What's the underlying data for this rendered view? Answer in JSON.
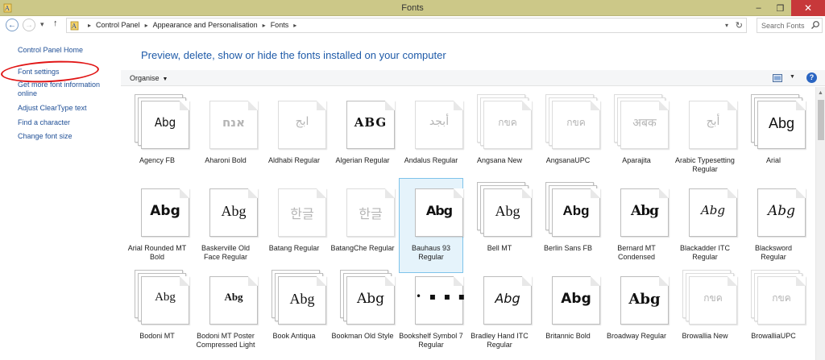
{
  "window": {
    "title": "Fonts",
    "minimize": "–",
    "restore": "❐",
    "close": "✕"
  },
  "address": {
    "crumbs": [
      "Control Panel",
      "Appearance and Personalisation",
      "Fonts"
    ],
    "separator": "▸",
    "search_placeholder": "Search Fonts"
  },
  "tasks": {
    "home": "Control Panel Home",
    "font_settings": "Font settings",
    "more_info": "Get more font information online",
    "cleartype": "Adjust ClearType text",
    "find_char": "Find a character",
    "font_size": "Change font size"
  },
  "main": {
    "heading": "Preview, delete, show or hide the fonts installed on your computer",
    "organise": "Organise"
  },
  "fonts": [
    {
      "name": "Agency FB",
      "sample": "Abg",
      "stack": true,
      "faded": false
    },
    {
      "name": "Aharoni Bold",
      "sample": "אנח",
      "stack": false,
      "faded": true
    },
    {
      "name": "Aldhabi Regular",
      "sample": "ابج",
      "stack": false,
      "faded": true
    },
    {
      "name": "Algerian Regular",
      "sample": "ABG",
      "stack": false,
      "faded": false
    },
    {
      "name": "Andalus Regular",
      "sample": "أبجد",
      "stack": false,
      "faded": true
    },
    {
      "name": "Angsana New",
      "sample": "กขค",
      "stack": true,
      "faded": true
    },
    {
      "name": "AngsanaUPC",
      "sample": "กขค",
      "stack": true,
      "faded": true
    },
    {
      "name": "Aparajita",
      "sample": "अबक",
      "stack": true,
      "faded": true
    },
    {
      "name": "Arabic Typesetting Regular",
      "sample": "أبج",
      "stack": false,
      "faded": true
    },
    {
      "name": "Arial",
      "sample": "Abg",
      "stack": true,
      "faded": false
    },
    {
      "name": "Arial Rounded MT Bold",
      "sample": "Abg",
      "stack": false,
      "faded": false
    },
    {
      "name": "Baskerville Old Face Regular",
      "sample": "Abg",
      "stack": false,
      "faded": false
    },
    {
      "name": "Batang Regular",
      "sample": "한글",
      "stack": false,
      "faded": true
    },
    {
      "name": "BatangChe Regular",
      "sample": "한글",
      "stack": false,
      "faded": true
    },
    {
      "name": "Bauhaus 93 Regular",
      "sample": "Abg",
      "stack": false,
      "faded": false
    },
    {
      "name": "Bell MT",
      "sample": "Abg",
      "stack": true,
      "faded": false
    },
    {
      "name": "Berlin Sans FB",
      "sample": "Abg",
      "stack": true,
      "faded": false
    },
    {
      "name": "Bernard MT Condensed",
      "sample": "Abg",
      "stack": false,
      "faded": false
    },
    {
      "name": "Blackadder ITC Regular",
      "sample": "Abg",
      "stack": false,
      "faded": false
    },
    {
      "name": "Blacksword Regular",
      "sample": "Abg",
      "stack": false,
      "faded": false
    },
    {
      "name": "Bodoni MT",
      "sample": "Abg",
      "stack": true,
      "faded": false
    },
    {
      "name": "Bodoni MT Poster Compressed Light",
      "sample": "Abg",
      "stack": false,
      "faded": false
    },
    {
      "name": "Book Antiqua",
      "sample": "Abg",
      "stack": true,
      "faded": false
    },
    {
      "name": "Bookman Old Style",
      "sample": "Abg",
      "stack": true,
      "faded": false
    },
    {
      "name": "Bookshelf Symbol 7 Regular",
      "sample": "• ▪ ▪ ▪",
      "stack": false,
      "faded": false
    },
    {
      "name": "Bradley Hand ITC Regular",
      "sample": "Abg",
      "stack": false,
      "faded": false
    },
    {
      "name": "Britannic Bold",
      "sample": "Abg",
      "stack": false,
      "faded": false
    },
    {
      "name": "Broadway Regular",
      "sample": "Abg",
      "stack": false,
      "faded": false
    },
    {
      "name": "Browallia New",
      "sample": "กขค",
      "stack": true,
      "faded": true
    },
    {
      "name": "BrowalliaUPC",
      "sample": "กขค",
      "stack": true,
      "faded": true
    }
  ],
  "selected_font": "Bauhaus 93 Regular",
  "colors": {
    "titlebar": "#ccc888",
    "close": "#c7383a",
    "link": "#1f4f96",
    "heading": "#1e5aa8",
    "annotation_circle": "#e11515",
    "selection": "#e5f3fb"
  }
}
